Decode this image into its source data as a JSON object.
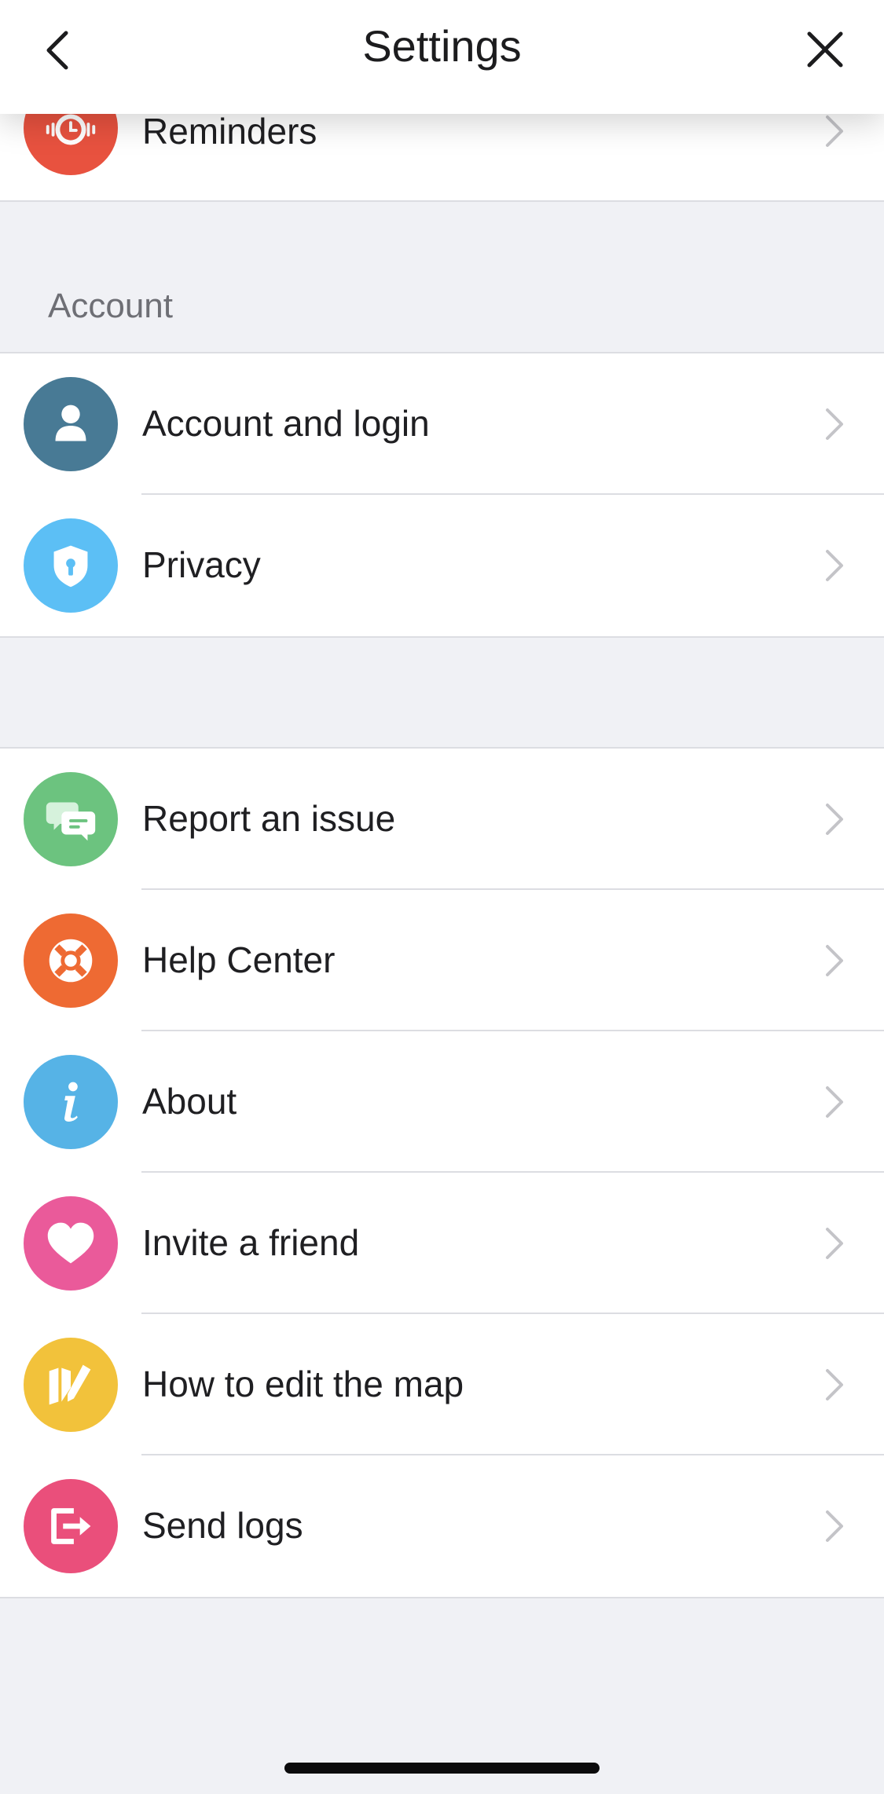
{
  "header": {
    "title": "Settings"
  },
  "partial_row": {
    "label": "Reminders",
    "icon": "alarm-clock-icon",
    "color": "#e8523f"
  },
  "sections": {
    "account_label": "Account",
    "account_items": [
      {
        "label": "Account and login",
        "icon": "user-icon",
        "color": "#487a95"
      },
      {
        "label": "Privacy",
        "icon": "shield-lock-icon",
        "color": "#5cbff5"
      }
    ],
    "support_items": [
      {
        "label": "Report an issue",
        "icon": "chat-bubbles-icon",
        "color": "#6cc37f"
      },
      {
        "label": "Help Center",
        "icon": "lifebuoy-icon",
        "color": "#ee6a33"
      },
      {
        "label": "About",
        "icon": "info-icon",
        "color": "#56b3e6"
      },
      {
        "label": "Invite a friend",
        "icon": "heart-icon",
        "color": "#ea5a9a"
      },
      {
        "label": "How to edit the map",
        "icon": "map-pen-icon",
        "color": "#f2c23b"
      },
      {
        "label": "Send logs",
        "icon": "export-icon",
        "color": "#ea4f7b"
      }
    ]
  }
}
